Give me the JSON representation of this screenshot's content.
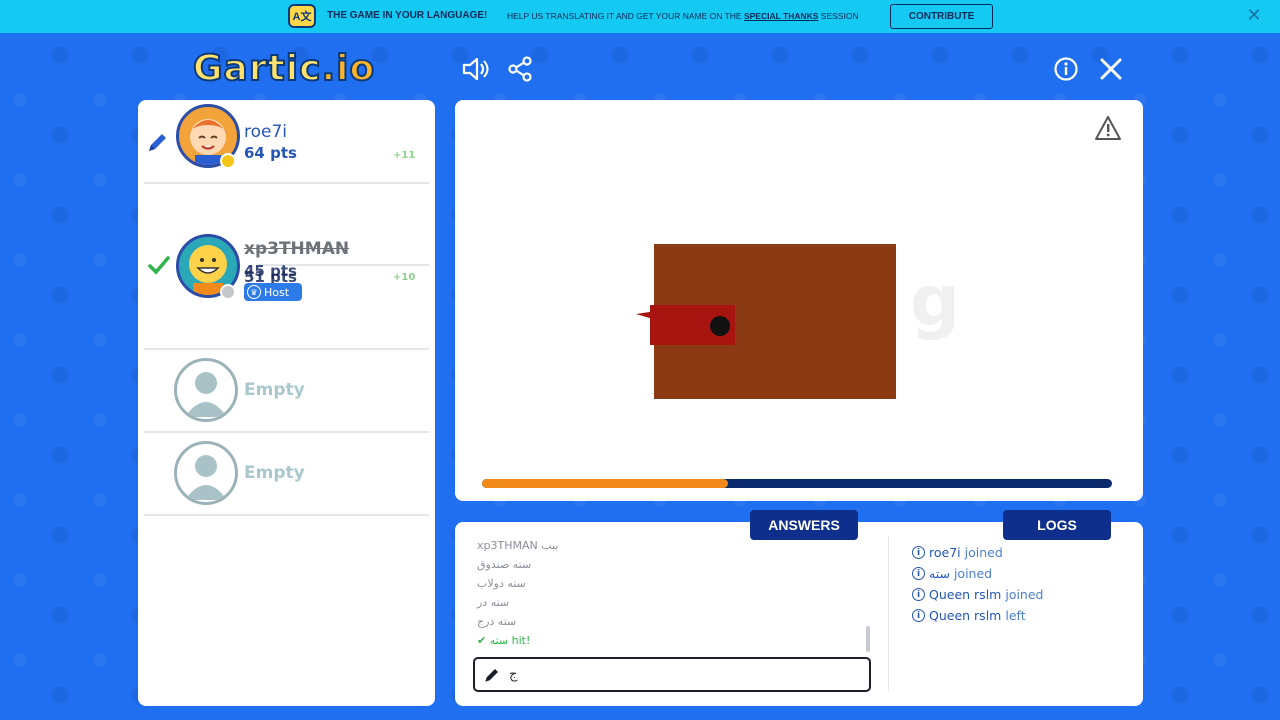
{
  "banner": {
    "headline": "THE GAME IN YOUR LANGUAGE!",
    "text_before": "HELP US TRANSLATING IT AND GET YOUR NAME ON THE ",
    "link": "SPECIAL THANKS",
    "text_after": " SESSION",
    "contribute_label": "CONTRIBUTE",
    "close_icon": "close-icon",
    "translate_icon": "translate-icon"
  },
  "logo": {
    "text": "Gartic",
    "suffix": ".io"
  },
  "toolbar": {
    "sound_icon": "speaker-icon",
    "share_icon": "share-icon",
    "info_icon": "info-icon",
    "close_icon": "close-icon"
  },
  "players": [
    {
      "name": "roe7i",
      "points": "64 pts",
      "delta": "+11",
      "drawing": true
    },
    {
      "name": "xp3THMAN",
      "points": "45 pts",
      "points_overlay": "51 pts",
      "delta": "+10",
      "guessed": true,
      "badge": "Host"
    },
    {
      "name": "Empty"
    },
    {
      "name": "Empty"
    }
  ],
  "board": {
    "report_icon": "warning-icon",
    "progress": 0.39,
    "colors": {
      "box": "#8b3a13",
      "lock": "#a8140f",
      "progress_fill": "#f28a1a",
      "progress_bg": "#0b2a6e"
    }
  },
  "chat": {
    "answers_tab": "ANSWERS",
    "logs_tab": "LOGS",
    "answers": [
      "xp3THMAN ببب",
      "سته صندوق",
      "سته دولاب",
      "سته در",
      "سته درج",
      "سته hit!"
    ],
    "input_value": "ج",
    "logs": [
      {
        "name": "roe7i",
        "action": "joined"
      },
      {
        "name": "سته",
        "action": "joined"
      },
      {
        "name": "Queen rslm",
        "action": "joined"
      },
      {
        "name": "Queen rslm",
        "action": "left"
      }
    ]
  }
}
